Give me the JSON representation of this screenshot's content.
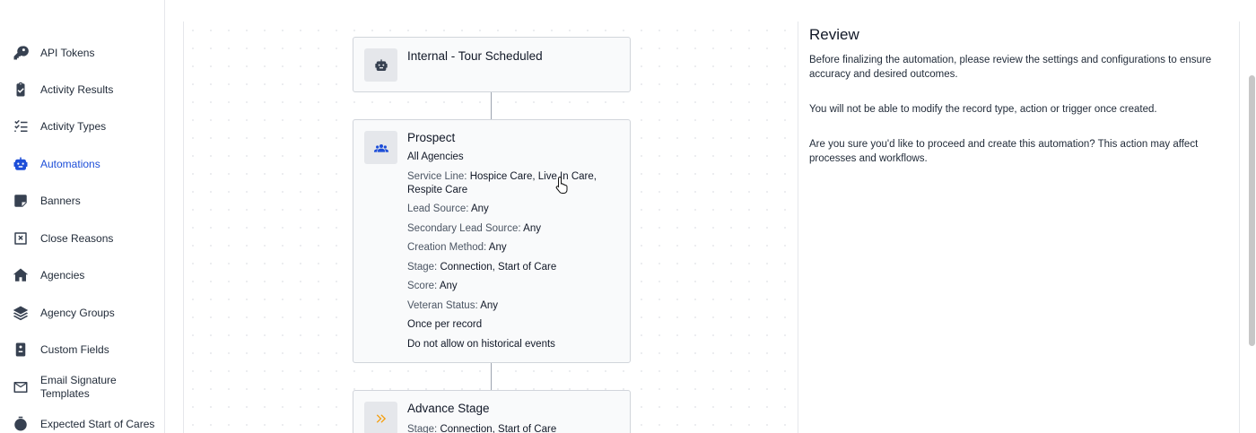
{
  "sidebar": {
    "items": [
      {
        "label": "API Tokens",
        "icon": "key-icon"
      },
      {
        "label": "Activity Results",
        "icon": "clipboard-check-icon"
      },
      {
        "label": "Activity Types",
        "icon": "checklist-icon"
      },
      {
        "label": "Automations",
        "icon": "robot-icon",
        "active": true
      },
      {
        "label": "Banners",
        "icon": "note-icon"
      },
      {
        "label": "Close Reasons",
        "icon": "x-box-icon"
      },
      {
        "label": "Agencies",
        "icon": "home-icon"
      },
      {
        "label": "Agency Groups",
        "icon": "layers-icon"
      },
      {
        "label": "Custom Fields",
        "icon": "file-icon"
      },
      {
        "label": "Email Signature Templates",
        "label_line1": "Email Signature",
        "label_line2": "Templates",
        "icon": "mail-icon"
      },
      {
        "label": "Expected Start of Cares",
        "icon": "stopwatch-icon"
      }
    ]
  },
  "flow": {
    "trigger": {
      "title": "Internal - Tour Scheduled",
      "icon": "robot-icon"
    },
    "filter": {
      "title": "Prospect",
      "icon": "people-icon",
      "lines": [
        {
          "key": "",
          "value": "All Agencies"
        },
        {
          "key": "Service Line: ",
          "value": "Hospice Care, Live In Care, Respite Care"
        },
        {
          "key": "Lead Source: ",
          "value": "Any"
        },
        {
          "key": "Secondary Lead Source: ",
          "value": "Any"
        },
        {
          "key": "Creation Method: ",
          "value": "Any"
        },
        {
          "key": "Stage: ",
          "value": "Connection, Start of Care"
        },
        {
          "key": "Score: ",
          "value": "Any"
        },
        {
          "key": "Veteran Status: ",
          "value": "Any"
        },
        {
          "key": "",
          "value": "Once per record"
        },
        {
          "key": "",
          "value": "Do not allow on historical events"
        }
      ]
    },
    "action": {
      "title": "Advance Stage",
      "icon": "chevrons-right-icon",
      "line_key": "Stage: ",
      "line_value": "Connection, Start of Care"
    }
  },
  "review": {
    "title": "Review",
    "p1": "Before finalizing the automation, please review the settings and configurations to ensure accuracy and desired outcomes.",
    "p2": "You will not be able to modify the record type, action or trigger once created.",
    "p3": "Are you sure you'd like to proceed and create this automation? This action may affect processes and workflows."
  },
  "colors": {
    "accent": "#1d4ed8",
    "action_icon": "#f59e0b"
  }
}
